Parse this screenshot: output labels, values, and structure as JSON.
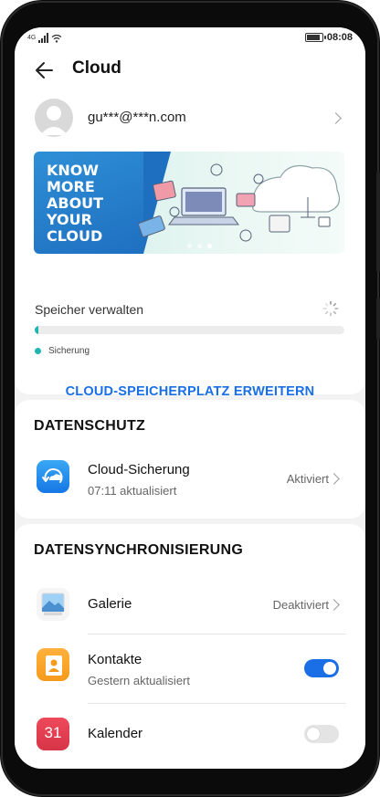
{
  "status_bar": {
    "network": "4G",
    "time": "08:08"
  },
  "header": {
    "title": "Cloud"
  },
  "account": {
    "email": "gu***@***n.com"
  },
  "banner": {
    "line1": "KNOW",
    "line2": "MORE",
    "line3": "ABOUT",
    "line4": "YOUR",
    "line5": "CLOUD",
    "page_count": 3,
    "active_page": 2
  },
  "storage": {
    "label": "Speicher verwalten",
    "legend": "Sicherung",
    "used_fraction": 0.005
  },
  "expand_button": "CLOUD-SPEICHERPLATZ ERWEITERN",
  "privacy": {
    "section_title": "DATENSCHUTZ",
    "backup": {
      "title": "Cloud-Sicherung",
      "subtitle": "07:11  aktualisiert",
      "status": "Aktiviert"
    }
  },
  "sync": {
    "section_title": "DATENSYNCHRONISIERUNG",
    "gallery": {
      "title": "Galerie",
      "status": "Deaktiviert"
    },
    "contacts": {
      "title": "Kontakte",
      "subtitle": "Gestern aktualisiert",
      "enabled": true
    },
    "calendar": {
      "title": "Kalender",
      "icon_day": "31",
      "enabled": false
    }
  },
  "colors": {
    "accent": "#1a6fe6",
    "teal": "#1fb5b0",
    "toggle_on": "#1a6fe6",
    "toggle_off": "#e4e4e4"
  }
}
